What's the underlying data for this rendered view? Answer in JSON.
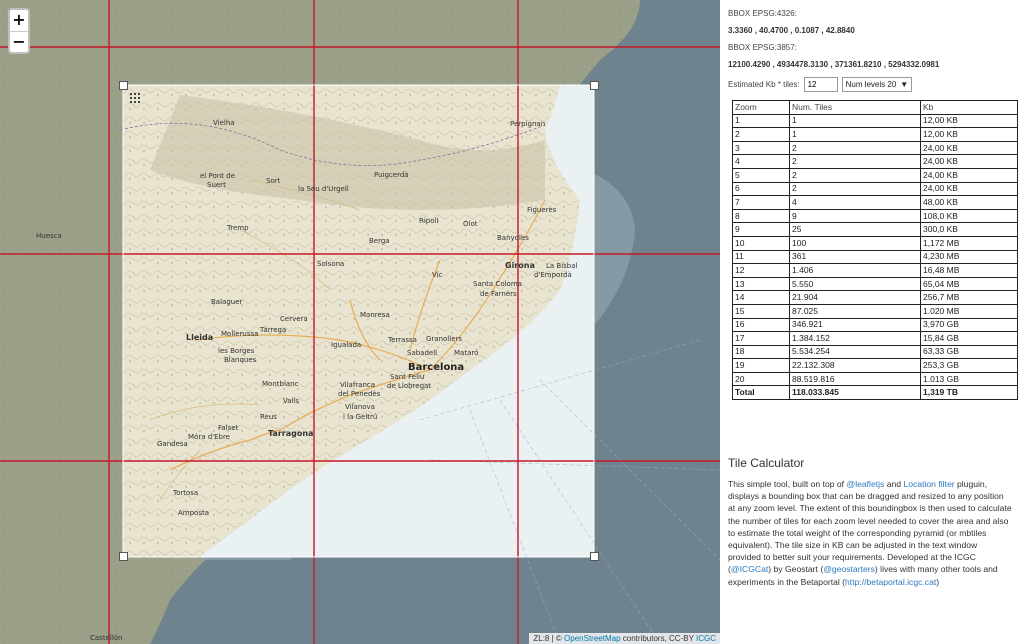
{
  "map": {
    "zoom_in_label": "+",
    "zoom_out_label": "−",
    "places": [
      {
        "id": "vielha",
        "name": "Vielha",
        "cls": ""
      },
      {
        "id": "pont-suert",
        "name": "el Pont de",
        "cls": ""
      },
      {
        "id": "suert",
        "name": "Suert",
        "cls": ""
      },
      {
        "id": "sort",
        "name": "Sort",
        "cls": ""
      },
      {
        "id": "seu",
        "name": "la Seu d'Urgell",
        "cls": ""
      },
      {
        "id": "puigcerda",
        "name": "Puigcerdà",
        "cls": ""
      },
      {
        "id": "perpignan",
        "name": "Perpignan",
        "cls": ""
      },
      {
        "id": "figueres",
        "name": "Figueres",
        "cls": ""
      },
      {
        "id": "huesca",
        "name": "Huesca",
        "cls": ""
      },
      {
        "id": "tremp",
        "name": "Tremp",
        "cls": ""
      },
      {
        "id": "ripoll",
        "name": "Ripoll",
        "cls": ""
      },
      {
        "id": "olot",
        "name": "Olot",
        "cls": ""
      },
      {
        "id": "berga",
        "name": "Berga",
        "cls": ""
      },
      {
        "id": "banyoles",
        "name": "Banyoles",
        "cls": ""
      },
      {
        "id": "solsona",
        "name": "Solsona",
        "cls": ""
      },
      {
        "id": "girona",
        "name": "Girona",
        "cls": "med"
      },
      {
        "id": "bisbal",
        "name": "La Bisbal",
        "cls": ""
      },
      {
        "id": "emporda",
        "name": "d'Empordà",
        "cls": ""
      },
      {
        "id": "vic",
        "name": "Vic",
        "cls": ""
      },
      {
        "id": "santa-coloma",
        "name": "Santa Coloma",
        "cls": ""
      },
      {
        "id": "farners",
        "name": "de Farners",
        "cls": ""
      },
      {
        "id": "balaguer",
        "name": "Balaguer",
        "cls": ""
      },
      {
        "id": "cervera",
        "name": "Cervera",
        "cls": ""
      },
      {
        "id": "manresa",
        "name": "Manresa",
        "cls": ""
      },
      {
        "id": "lleida",
        "name": "Lleida",
        "cls": "med"
      },
      {
        "id": "mollerussa",
        "name": "Mollerussa",
        "cls": ""
      },
      {
        "id": "tarrega",
        "name": "Tàrrega",
        "cls": ""
      },
      {
        "id": "borges",
        "name": "les Borges",
        "cls": ""
      },
      {
        "id": "blanques",
        "name": "Blanques",
        "cls": ""
      },
      {
        "id": "igualada",
        "name": "Igualada",
        "cls": ""
      },
      {
        "id": "terrassa",
        "name": "Terrassa",
        "cls": ""
      },
      {
        "id": "granollers",
        "name": "Granollers",
        "cls": ""
      },
      {
        "id": "sabadell",
        "name": "Sabadell",
        "cls": ""
      },
      {
        "id": "mataro",
        "name": "Mataró",
        "cls": ""
      },
      {
        "id": "barcelona",
        "name": "Barcelona",
        "cls": "big"
      },
      {
        "id": "montblanc",
        "name": "Montblanc",
        "cls": ""
      },
      {
        "id": "valls",
        "name": "Valls",
        "cls": ""
      },
      {
        "id": "vilafranca",
        "name": "Vilafranca",
        "cls": ""
      },
      {
        "id": "penedes",
        "name": "del Penedès",
        "cls": ""
      },
      {
        "id": "sant-feliu",
        "name": "Sant Feliu",
        "cls": ""
      },
      {
        "id": "llobregat",
        "name": "de Llobregat",
        "cls": ""
      },
      {
        "id": "vilanova",
        "name": "Vilanova",
        "cls": ""
      },
      {
        "id": "geltru",
        "name": "i la Geltrú",
        "cls": ""
      },
      {
        "id": "reus",
        "name": "Reus",
        "cls": ""
      },
      {
        "id": "tarragona",
        "name": "Tarragona",
        "cls": "med"
      },
      {
        "id": "falset",
        "name": "Falset",
        "cls": ""
      },
      {
        "id": "gandesa",
        "name": "Gandesa",
        "cls": ""
      },
      {
        "id": "mora",
        "name": "Móra d'Ebre",
        "cls": ""
      },
      {
        "id": "tortosa",
        "name": "Tortosa",
        "cls": ""
      },
      {
        "id": "amposta",
        "name": "Amposta",
        "cls": ""
      },
      {
        "id": "castellon",
        "name": "Castellón",
        "cls": ""
      }
    ],
    "attribution": {
      "prefix": "ZL:8 | ©",
      "osm_link": "OpenStreetMap",
      "middle": "contributors, CC-BY",
      "icgc_link": "ICGC"
    }
  },
  "panel": {
    "bbox4326_label": "BBOX EPSG:4326:",
    "bbox4326_value": "3.3360 , 40.4700 , 0.1087 , 42.8840",
    "bbox3857_label": "BBOX EPSG:3857:",
    "bbox3857_value": "12100.4290 , 4934478.3130 , 371361.8210 , 5294332.0981",
    "estimated_label": "Estimated Kb * tiles:",
    "estimated_value": "12",
    "levels_selected": "Num levels 20",
    "table": {
      "headers": [
        "Zoom",
        "Num. Tiles",
        "Kb"
      ],
      "rows": [
        [
          "1",
          "1",
          "12,00 KB"
        ],
        [
          "2",
          "1",
          "12,00 KB"
        ],
        [
          "3",
          "2",
          "24,00 KB"
        ],
        [
          "4",
          "2",
          "24,00 KB"
        ],
        [
          "5",
          "2",
          "24,00 KB"
        ],
        [
          "6",
          "2",
          "24,00 KB"
        ],
        [
          "7",
          "4",
          "48,00 KB"
        ],
        [
          "8",
          "9",
          "108,0 KB"
        ],
        [
          "9",
          "25",
          "300,0 KB"
        ],
        [
          "10",
          "100",
          "1,172 MB"
        ],
        [
          "11",
          "361",
          "4,230 MB"
        ],
        [
          "12",
          "1.406",
          "16,48 MB"
        ],
        [
          "13",
          "5.550",
          "65,04 MB"
        ],
        [
          "14",
          "21.904",
          "256,7 MB"
        ],
        [
          "15",
          "87.025",
          "1.020 MB"
        ],
        [
          "16",
          "346.921",
          "3,970 GB"
        ],
        [
          "17",
          "1.384.152",
          "15,84 GB"
        ],
        [
          "18",
          "5.534.254",
          "63,33 GB"
        ],
        [
          "19",
          "22.132.308",
          "253,3 GB"
        ],
        [
          "20",
          "88.519.816",
          "1.013 GB"
        ]
      ],
      "total": [
        "Total",
        "118.033.845",
        "1,319 TB"
      ]
    },
    "about": {
      "title": "Tile Calculator",
      "t1": "This simple tool, built on top of ",
      "l1": "@leafletjs",
      "t2": " and ",
      "l2": "Location filter",
      "t3": " pluguin, displays a bounding box that can be dragged and resized to any position at any zoom level. The extent of this boundingbox is then used to calculate the number of tiles for each zoom level needed to cover the area and also to estimate the total weight of the corresponding pyramid (or mbtiles equivalent). The tile size in KB can be adjusted in the text window provided to better suit your requirements. Developed at the ICGC (",
      "l3": "@ICGCat",
      "t4": ") by Geostart (",
      "l4": "@geostarters",
      "t5": ") lives with many other tools and experiments in the Betaportal (",
      "l5": "http://betaportal.icgc.cat",
      "t6": ")"
    }
  }
}
